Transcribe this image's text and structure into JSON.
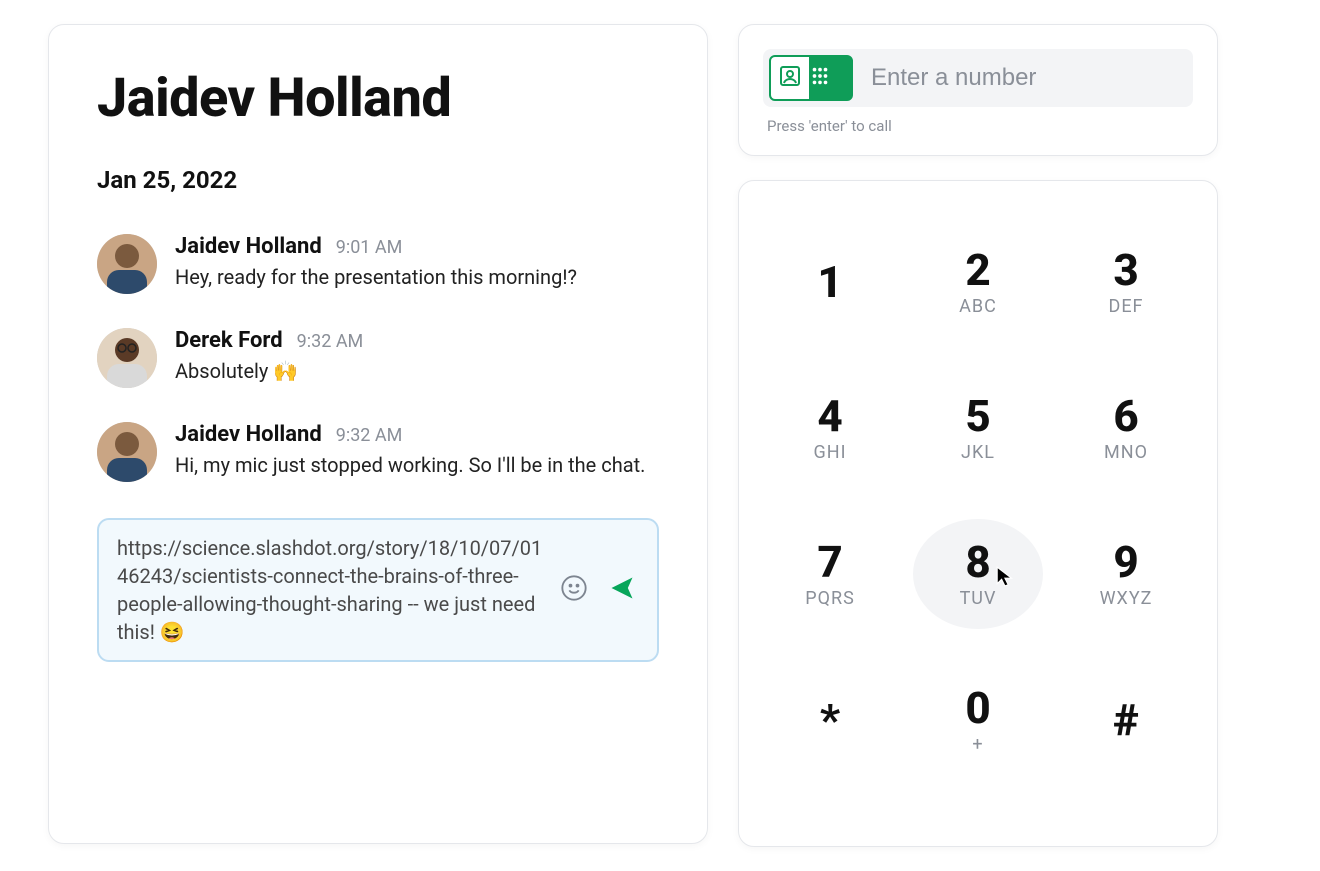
{
  "chat": {
    "title": "Jaidev Holland",
    "date": "Jan 25, 2022",
    "messages": [
      {
        "name": "Jaidev Holland",
        "time": "9:01 AM",
        "text": "Hey, ready for the presentation this morning!?"
      },
      {
        "name": "Derek Ford",
        "time": "9:32 AM",
        "text": "Absolutely 🙌"
      },
      {
        "name": "Jaidev Holland",
        "time": "9:32 AM",
        "text": "Hi, my mic just stopped working. So I'll be in the chat."
      }
    ],
    "composer_text": "https://science.slashdot.org/story/18/10/07/0146243/scientists-connect-the-brains-of-three-people-allowing-thought-sharing -- we just need this! 😆"
  },
  "dialer": {
    "placeholder": "Enter a number",
    "hint": "Press 'enter' to call",
    "keys": [
      {
        "digit": "1",
        "letters": ""
      },
      {
        "digit": "2",
        "letters": "ABC"
      },
      {
        "digit": "3",
        "letters": "DEF"
      },
      {
        "digit": "4",
        "letters": "GHI"
      },
      {
        "digit": "5",
        "letters": "JKL"
      },
      {
        "digit": "6",
        "letters": "MNO"
      },
      {
        "digit": "7",
        "letters": "PQRS"
      },
      {
        "digit": "8",
        "letters": "TUV"
      },
      {
        "digit": "9",
        "letters": "WXYZ"
      },
      {
        "digit": "*",
        "letters": ""
      },
      {
        "digit": "0",
        "letters": "+"
      },
      {
        "digit": "#",
        "letters": ""
      }
    ],
    "hovered_index": 7
  }
}
